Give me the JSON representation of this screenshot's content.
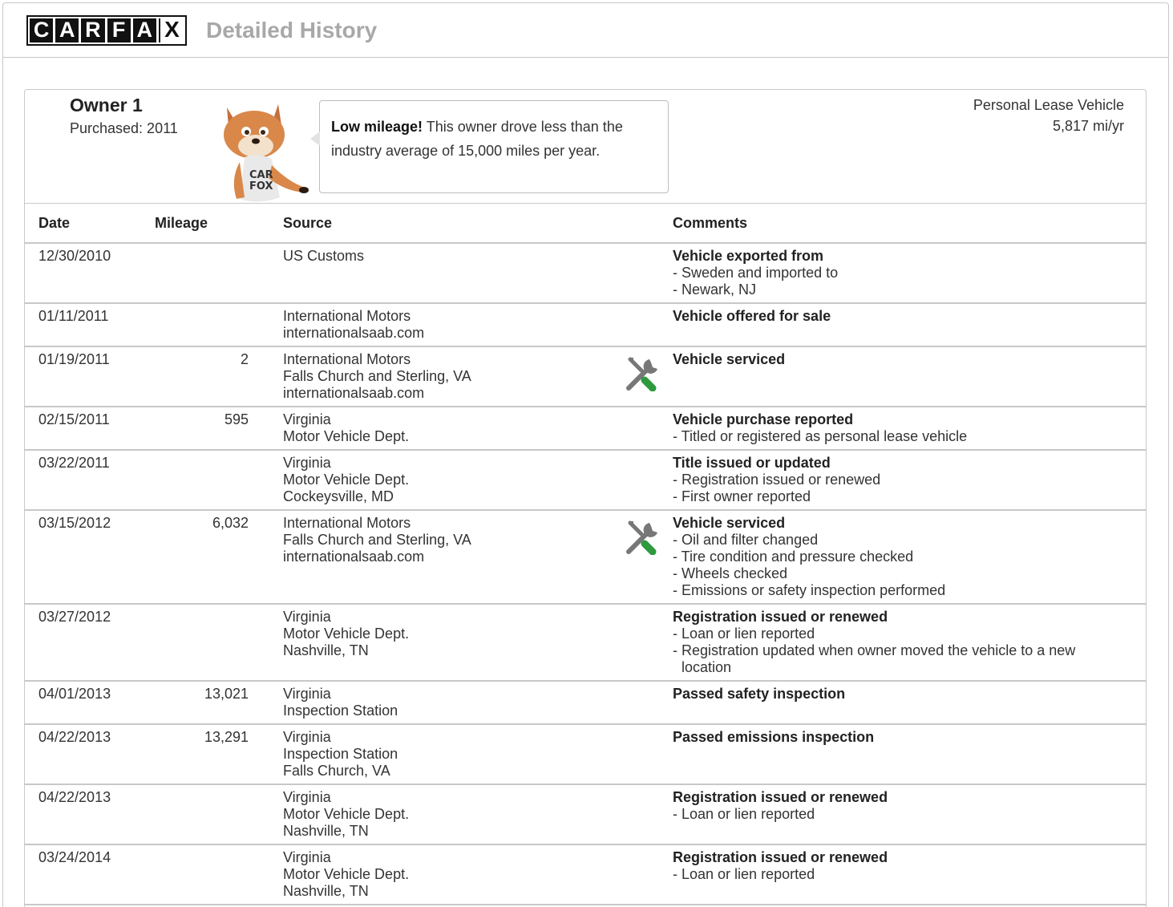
{
  "header": {
    "logo_letters": [
      "C",
      "A",
      "R",
      "F",
      "A",
      "X"
    ],
    "title": "Detailed History"
  },
  "owner": {
    "title": "Owner 1",
    "purchased": "Purchased: 2011",
    "bubble_bold": "Low mileage!",
    "bubble_text": " This owner drove less than the industry average of 15,000 miles per year.",
    "lease_type": "Personal Lease Vehicle",
    "miles_per_year": "5,817 mi/yr"
  },
  "table": {
    "headers": {
      "date": "Date",
      "mileage": "Mileage",
      "source": "Source",
      "comments": "Comments"
    },
    "rows": [
      {
        "date": "12/30/2010",
        "mileage": "",
        "source": [
          "US Customs"
        ],
        "service": false,
        "title": "Vehicle exported from",
        "details": [
          "- Sweden and imported to",
          "- Newark, NJ"
        ]
      },
      {
        "date": "01/11/2011",
        "mileage": "",
        "source": [
          "International Motors",
          "internationalsaab.com"
        ],
        "service": false,
        "title": "Vehicle offered for sale",
        "details": []
      },
      {
        "date": "01/19/2011",
        "mileage": "2",
        "source": [
          "International Motors",
          "Falls Church and Sterling, VA",
          "internationalsaab.com"
        ],
        "service": true,
        "title": "Vehicle serviced",
        "details": []
      },
      {
        "date": "02/15/2011",
        "mileage": "595",
        "source": [
          "Virginia",
          "Motor Vehicle Dept."
        ],
        "service": false,
        "title": "Vehicle purchase reported",
        "details": [
          "- Titled or registered as personal lease vehicle"
        ]
      },
      {
        "date": "03/22/2011",
        "mileage": "",
        "source": [
          "Virginia",
          "Motor Vehicle Dept.",
          "Cockeysville, MD"
        ],
        "service": false,
        "title": "Title issued or updated",
        "details": [
          "- Registration issued or renewed",
          "- First owner reported"
        ]
      },
      {
        "date": "03/15/2012",
        "mileage": "6,032",
        "source": [
          "International Motors",
          "Falls Church and Sterling, VA",
          "internationalsaab.com"
        ],
        "service": true,
        "title": "Vehicle serviced",
        "details": [
          "- Oil and filter changed",
          "- Tire condition and pressure checked",
          "- Wheels checked",
          "- Emissions or safety inspection performed"
        ]
      },
      {
        "date": "03/27/2012",
        "mileage": "",
        "source": [
          "Virginia",
          "Motor Vehicle Dept.",
          "Nashville, TN"
        ],
        "service": false,
        "title": "Registration issued or renewed",
        "details": [
          "- Loan or lien reported",
          "- Registration updated when owner moved the vehicle to a new location"
        ]
      },
      {
        "date": "04/01/2013",
        "mileage": "13,021",
        "source": [
          "Virginia",
          "Inspection Station"
        ],
        "service": false,
        "title": "Passed safety inspection",
        "details": []
      },
      {
        "date": "04/22/2013",
        "mileage": "13,291",
        "source": [
          "Virginia",
          "Inspection Station",
          "Falls Church, VA"
        ],
        "service": false,
        "title": "Passed emissions inspection",
        "details": []
      },
      {
        "date": "04/22/2013",
        "mileage": "",
        "source": [
          "Virginia",
          "Motor Vehicle Dept.",
          "Nashville, TN"
        ],
        "service": false,
        "title": "Registration issued or renewed",
        "details": [
          "- Loan or lien reported"
        ]
      },
      {
        "date": "03/24/2014",
        "mileage": "",
        "source": [
          "Virginia",
          "Motor Vehicle Dept.",
          "Nashville, TN"
        ],
        "service": false,
        "title": "Registration issued or renewed",
        "details": [
          "- Loan or lien reported"
        ]
      }
    ]
  },
  "colors": {
    "border": "#c8c8c8",
    "title_gray": "#a8a8a8",
    "service_green": "#2e9a3e",
    "service_gray": "#777777"
  }
}
